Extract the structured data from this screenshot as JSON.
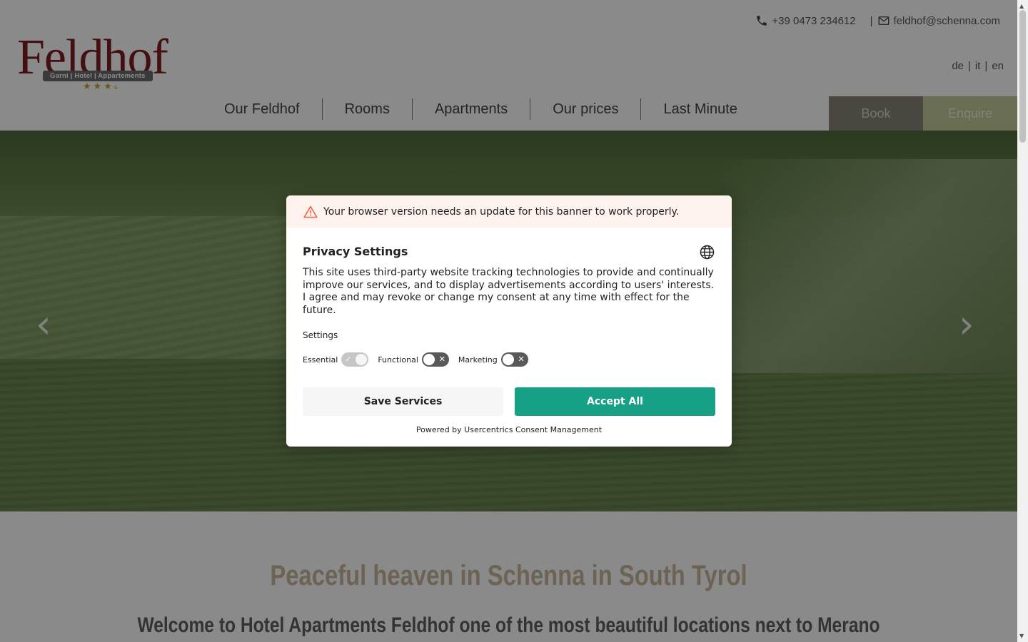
{
  "header": {
    "phone": "+39 0473 234612",
    "separator": "|",
    "email": "feldhof@schenna.com",
    "languages": [
      "de",
      "it",
      "en"
    ],
    "lang_separator": "|"
  },
  "logo": {
    "word": "Feldhof",
    "tagline": "Garni | Hotel | Appartements",
    "stars": "★★★",
    "half_star": "s"
  },
  "nav": {
    "items": [
      "Our Feldhof",
      "Rooms",
      "Apartments",
      "Our prices",
      "Last Minute"
    ],
    "book_label": "Book",
    "enquire_label": "Enquire"
  },
  "hero": {
    "prev_arrow": "‹",
    "next_arrow": "›"
  },
  "content": {
    "headline": "Peaceful heaven in Schenna in South Tyrol",
    "subhead": "Welcome to Hotel Apartments Feldhof one of the most beautiful locations next to Merano"
  },
  "consent": {
    "warning": "Your browser version needs an update for this banner to work properly.",
    "title": "Privacy Settings",
    "text": "This site uses third-party website tracking technologies to provide and continually improve our services, and to display advertisements according to users' interests. I agree and may revoke or change my consent at any time with effect for the future.",
    "settings_label": "Settings",
    "toggles": [
      {
        "label": "Essential",
        "state": "on"
      },
      {
        "label": "Functional",
        "state": "off"
      },
      {
        "label": "Marketing",
        "state": "off"
      }
    ],
    "save_label": "Save Services",
    "accept_label": "Accept All",
    "powered_by": "Powered by Usercentrics Consent Management"
  },
  "colors": {
    "brand": "#7d1c1f",
    "accept": "#16a085",
    "book": "#8a8378",
    "enquire": "#c3cc98",
    "warning": "#e8643c"
  }
}
